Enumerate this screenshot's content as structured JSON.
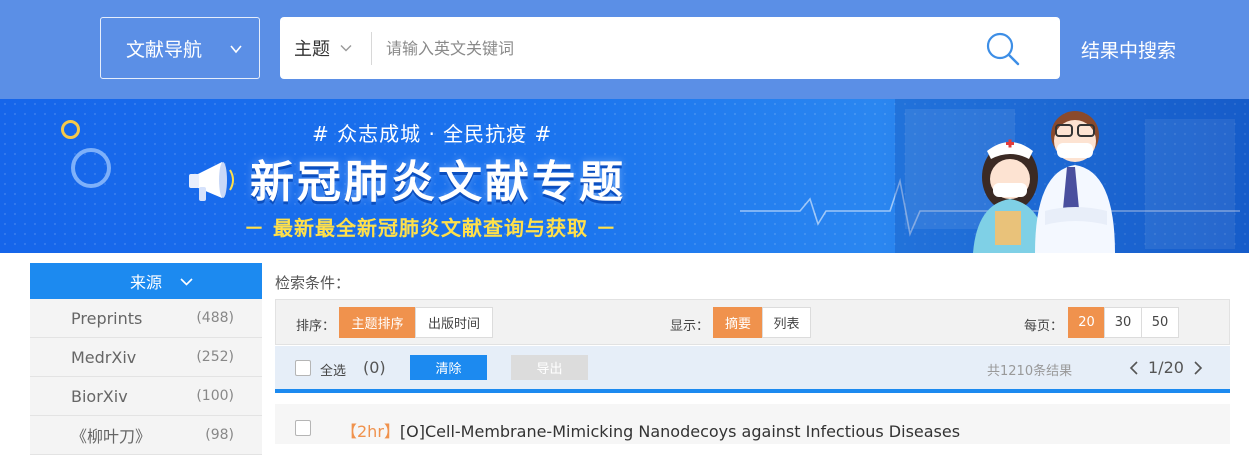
{
  "header": {
    "nav_label": "文献导航",
    "search_field": "主题",
    "search_placeholder": "请输入英文关键词",
    "refine_label": "结果中搜索"
  },
  "banner": {
    "slogan": "# 众志成城 · 全民抗疫 #",
    "title": "新冠肺炎文献专题",
    "tagline": "－ 最新最全新冠肺炎文献查询与获取 －"
  },
  "sidebar": {
    "header": "来源",
    "items": [
      {
        "label": "Preprints",
        "count": "(488)"
      },
      {
        "label": "MedrXiv",
        "count": "(252)"
      },
      {
        "label": "BiorXiv",
        "count": "(100)"
      },
      {
        "label": "《柳叶刀》",
        "count": "(98)"
      }
    ]
  },
  "criteria_label": "检索条件：",
  "toolbar": {
    "sort_label": "排序：",
    "sort_options": [
      "主题排序",
      "出版时间"
    ],
    "display_label": "显示：",
    "display_options": [
      "摘要",
      "列表"
    ],
    "per_page_label": "每页：",
    "per_page_options": [
      "20",
      "30",
      "50"
    ]
  },
  "selection": {
    "select_all": "全选",
    "count": "(0)",
    "clear": "清除",
    "export": "导出",
    "total": "共1210条结果",
    "page": "1/20"
  },
  "results": [
    {
      "tag": "【2hr】",
      "title": "[O]Cell-Membrane-Mimicking Nanodecoys against Infectious Diseases"
    }
  ],
  "colors": {
    "header_bg": "#5b8fe6",
    "accent_blue": "#1c8af0",
    "accent_orange": "#f0924d",
    "banner_yellow": "#ffe04a"
  }
}
